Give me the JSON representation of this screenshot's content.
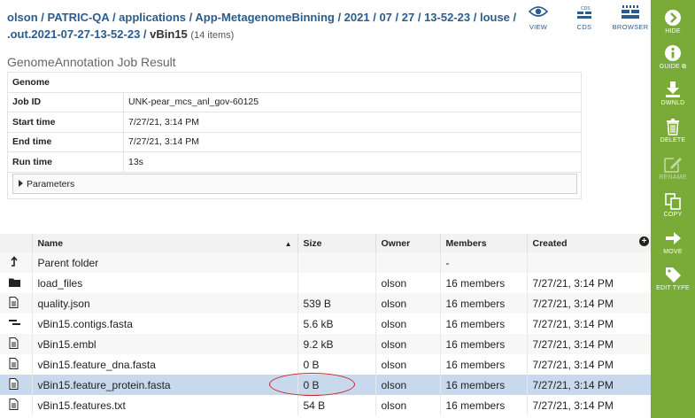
{
  "breadcrumb": {
    "parts": [
      "olson",
      "PATRIC-QA",
      "applications",
      "App-MetagenomeBinning",
      "2021",
      "07",
      "27",
      "13-52-23",
      "louse",
      ".out.2021-07-27-13-52-23"
    ],
    "current": "vBin15",
    "item_count": "(14 items)"
  },
  "toolbar": {
    "view": "VIEW",
    "cds": "CDS",
    "browser": "BROWSER"
  },
  "job": {
    "title": "GenomeAnnotation Job Result",
    "genome_label": "Genome",
    "rows": [
      {
        "key": "Job ID",
        "value": "UNK-pear_mcs_anl_gov-60125"
      },
      {
        "key": "Start time",
        "value": "7/27/21, 3:14 PM"
      },
      {
        "key": "End time",
        "value": "7/27/21, 3:14 PM"
      },
      {
        "key": "Run time",
        "value": "13s"
      }
    ],
    "parameters_label": "Parameters"
  },
  "files": {
    "columns": {
      "name": "Name",
      "size": "Size",
      "owner": "Owner",
      "members": "Members",
      "created": "Created"
    },
    "rows": [
      {
        "icon": "up-arrow-icon",
        "name": "Parent folder",
        "size": "",
        "owner": "",
        "members": "-",
        "created": ""
      },
      {
        "icon": "folder-icon",
        "name": "load_files",
        "size": "",
        "owner": "olson",
        "members": "16 members",
        "created": "7/27/21, 3:14 PM"
      },
      {
        "icon": "document-icon",
        "name": "quality.json",
        "size": "539 B",
        "owner": "olson",
        "members": "16 members",
        "created": "7/27/21, 3:14 PM"
      },
      {
        "icon": "contigs-icon",
        "name": "vBin15.contigs.fasta",
        "size": "5.6 kB",
        "owner": "olson",
        "members": "16 members",
        "created": "7/27/21, 3:14 PM"
      },
      {
        "icon": "document-icon",
        "name": "vBin15.embl",
        "size": "9.2 kB",
        "owner": "olson",
        "members": "16 members",
        "created": "7/27/21, 3:14 PM"
      },
      {
        "icon": "document-icon",
        "name": "vBin15.feature_dna.fasta",
        "size": "0 B",
        "owner": "olson",
        "members": "16 members",
        "created": "7/27/21, 3:14 PM"
      },
      {
        "icon": "document-icon",
        "name": "vBin15.feature_protein.fasta",
        "size": "0 B",
        "owner": "olson",
        "members": "16 members",
        "created": "7/27/21, 3:14 PM"
      },
      {
        "icon": "document-icon",
        "name": "vBin15.features.txt",
        "size": "54 B",
        "owner": "olson",
        "members": "16 members",
        "created": "7/27/21, 3:14 PM"
      }
    ]
  },
  "sidebar": {
    "hide": "HIDE",
    "guide": "GUIDE",
    "download": "DWNLD",
    "delete": "DELETE",
    "rename": "RENAME",
    "copy": "COPY",
    "move": "MOVE",
    "edit_type": "EDIT TYPE"
  },
  "colors": {
    "sidebar": "#7aab38",
    "link": "#2a5c8f",
    "selected_row": "#c8d9ee",
    "highlight": "#c4262e"
  }
}
